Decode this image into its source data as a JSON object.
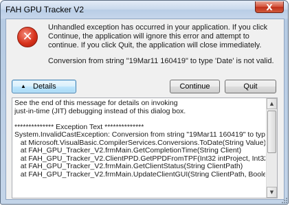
{
  "window": {
    "title": "FAH GPU Tracker V2",
    "close_glyph": "X"
  },
  "dialog": {
    "icon_glyph": "✕",
    "message": "Unhandled exception has occurred in your application. If you click Continue, the application will ignore this error and attempt to continue. If you click Quit, the application will close immediately.",
    "error_detail": "Conversion from string \"19Mar11 160419\" to type 'Date' is not valid."
  },
  "buttons": {
    "details_arrow": "▲",
    "details_label": "Details",
    "continue_label": "Continue",
    "quit_label": "Quit"
  },
  "details": {
    "text": "See the end of this message for details on invoking\njust-in-time (JIT) debugging instead of this dialog box.\n\n************** Exception Text **************\nSystem.InvalidCastException: Conversion from string \"19Mar11 160419\" to type 'Date\n   at Microsoft.VisualBasic.CompilerServices.Conversions.ToDate(String Value)\n   at FAH_GPU_Tracker_V2.frmMain.GetCompletionTime(String Client)\n   at FAH_GPU_Tracker_V2.ClientPPD.GetPPDFromTPF(Int32 intProject, Int32 Point\n   at FAH_GPU_Tracker_V2.frmMain.GetClientStatus(String ClientPath)\n   at FAH_GPU_Tracker_V2.frmMain.UpdateClientGUI(String ClientPath, Boolean All,",
    "scroll_up": "▲",
    "scroll_down": "▼"
  },
  "colors": {
    "title_bar": "#c8d8ec",
    "close_button": "#c8402a",
    "dialog_background": "#f0f0f0",
    "error_icon": "#d8321b"
  }
}
